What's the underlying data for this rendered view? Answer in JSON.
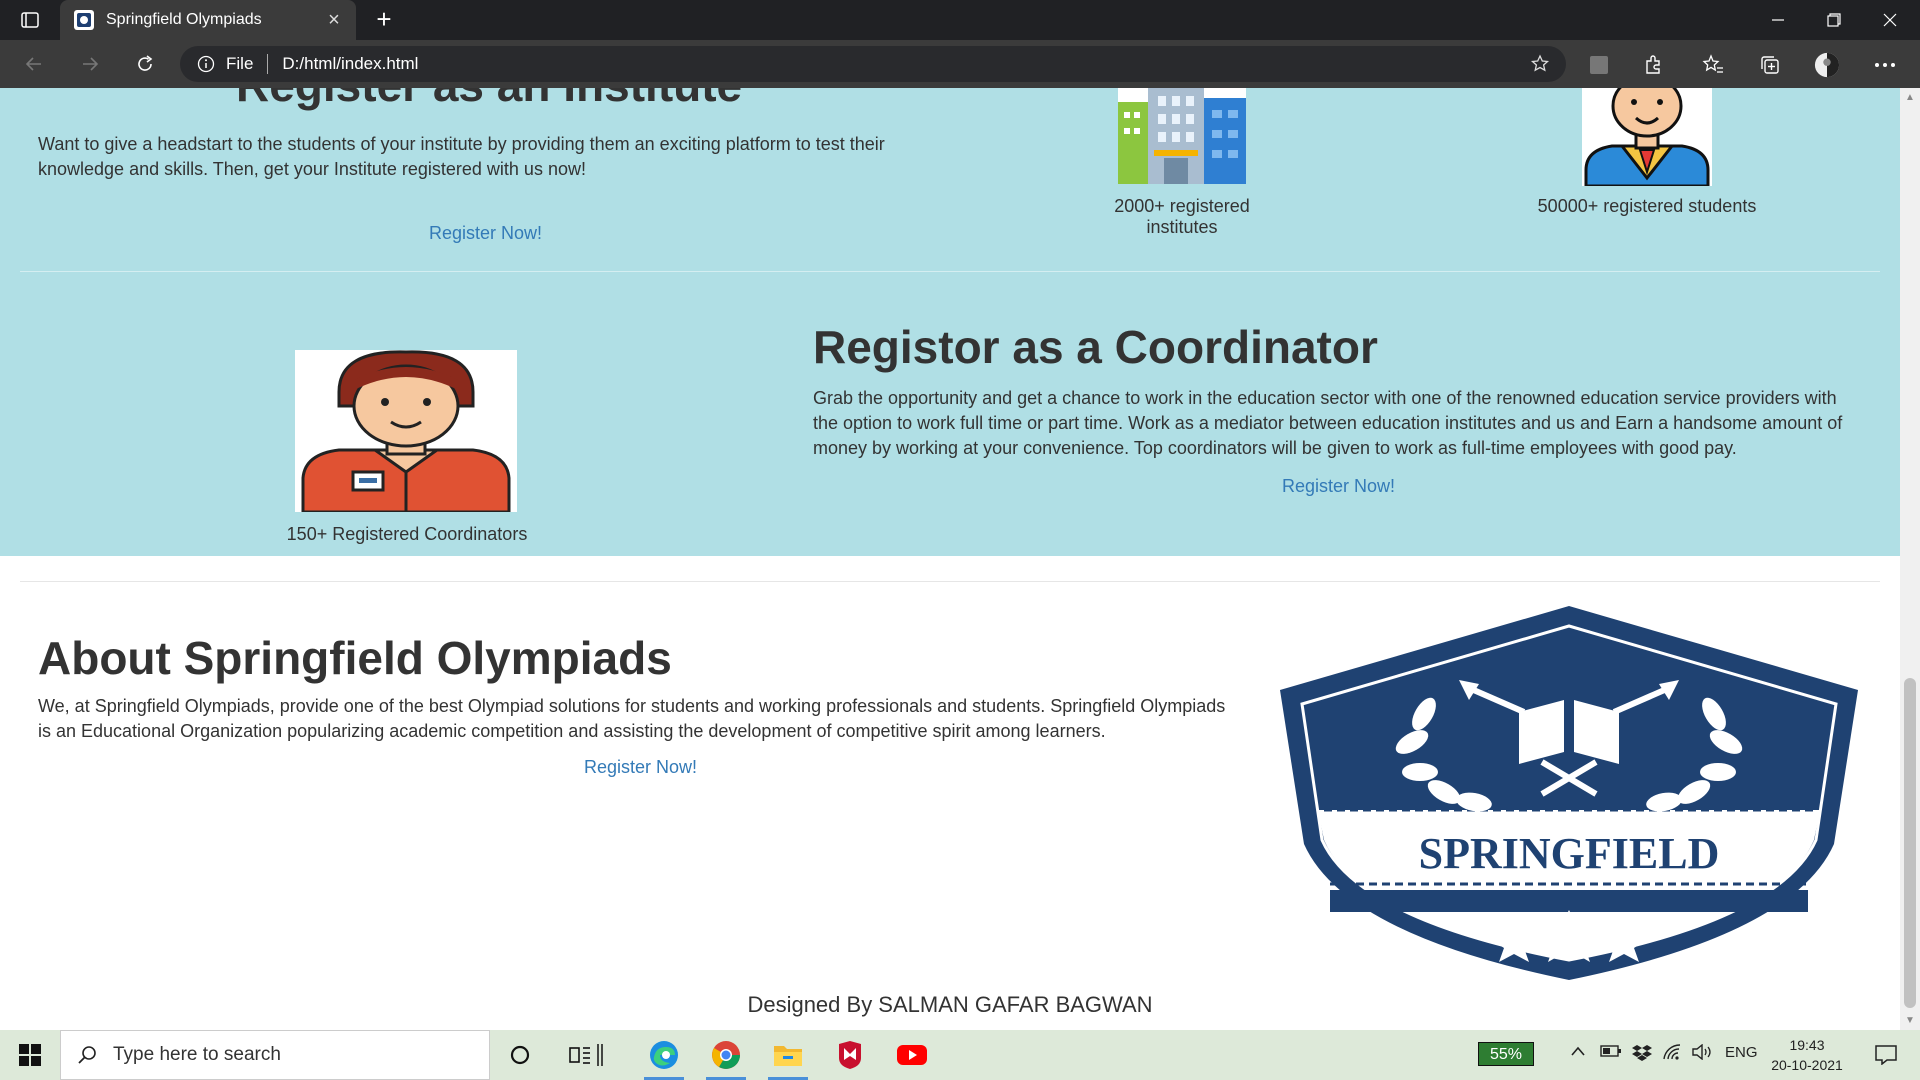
{
  "browser": {
    "tab_title": "Springfield Olympiads",
    "address_scheme": "File",
    "address_url": "D:/html/index.html"
  },
  "institute": {
    "heading": "Register as an Institute",
    "text": "Want to give a headstart to the students of your institute by providing them an exciting platform to test their knowledge and skills. Then, get your Institute registered with us now!",
    "link": "Register Now!",
    "stat_institutes": "2000+ registered institutes",
    "stat_students": "50000+ registered students"
  },
  "coordinator": {
    "heading": "Registor as a Coordinator",
    "text": "Grab the opportunity and get a chance to work in the education sector with one of the renowned education service providers with the option to work full time or part time. Work as a mediator between education institutes and us and Earn a handsome amount of money by working at your convenience. Top coordinators will be given to work as full-time employees with good pay.",
    "link": "Register Now!",
    "stat": "150+ Registered Coordinators"
  },
  "about": {
    "heading": "About Springfield Olympiads",
    "text": "We, at Springfield Olympiads, provide one of the best Olympiad solutions for students and working professionals and students. Springfield Olympiads is an Educational Organization popularizing academic competition and assisting the development of competitive spirit among learners.",
    "link": "Register Now!",
    "logo_text": "SPRINGFIELD"
  },
  "footer": {
    "credit": "Designed By SALMAN GAFAR BAGWAN"
  },
  "taskbar": {
    "search_placeholder": "Type here to search",
    "battery": "55%",
    "language": "ENG",
    "time": "19:43",
    "date": "20-10-2021"
  }
}
